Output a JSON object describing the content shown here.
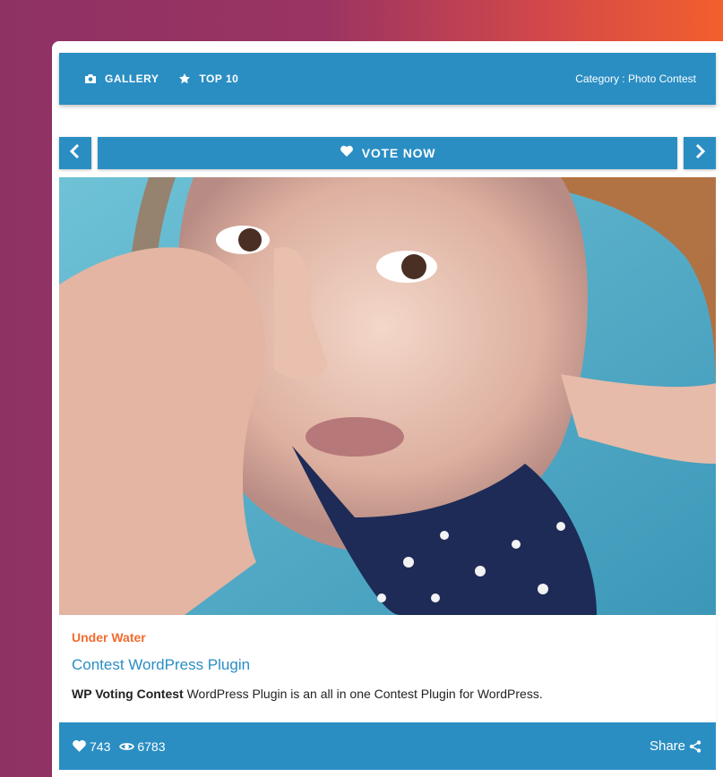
{
  "nav": {
    "gallery_label": "GALLERY",
    "top10_label": "TOP 10",
    "category_text": "Category : Photo Contest"
  },
  "actions": {
    "vote_label": "VOTE NOW"
  },
  "entry": {
    "category": "Under Water",
    "title": "Contest WordPress Plugin",
    "description_bold": "WP Voting Contest",
    "description_rest": "WordPress Plugin is an all in one Contest Plugin for WordPress.",
    "votes": "743",
    "views": "6783",
    "share_label": "Share"
  },
  "colors": {
    "accent": "#2a8ec3",
    "category_tag": "#f26b2f"
  },
  "icons": {
    "gallery": "camera-icon",
    "top10": "star-icon",
    "vote": "heart-icon",
    "prev": "chevron-left-icon",
    "next": "chevron-right-icon",
    "votes": "heart-icon",
    "views": "eye-icon",
    "share": "share-icon"
  }
}
